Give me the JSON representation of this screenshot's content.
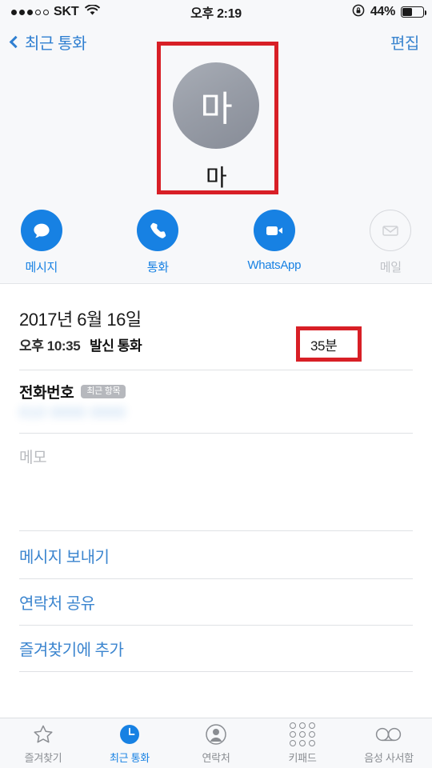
{
  "status_bar": {
    "signal_dots_filled": 3,
    "signal_dots_total": 5,
    "carrier": "SKT",
    "wifi_icon": "wifi-icon",
    "time": "오후 2:19",
    "rotation_lock_icon": "rotation-lock-icon",
    "battery_percent": "44%",
    "battery_level": 44
  },
  "nav_bar": {
    "back_icon": "chevron-left-icon",
    "back_label": "최근 통화",
    "edit_label": "편집"
  },
  "contact": {
    "avatar_initial": "마",
    "avatar_icon": "avatar-placeholder",
    "name": "마"
  },
  "actions": [
    {
      "id": "message",
      "label": "메시지",
      "icon": "message-bubble-icon",
      "enabled": true
    },
    {
      "id": "call",
      "label": "통화",
      "icon": "phone-handset-icon",
      "enabled": true
    },
    {
      "id": "whatsapp",
      "label": "WhatsApp",
      "icon": "video-camera-icon",
      "enabled": true
    },
    {
      "id": "mail",
      "label": "메일",
      "icon": "envelope-icon",
      "enabled": false
    }
  ],
  "call_record": {
    "date": "2017년 6월 16일",
    "time": "오후 10:35",
    "type": "발신 통화",
    "duration": "35분"
  },
  "fields": {
    "phone_label": "전화번호",
    "phone_badge": "최근 항목",
    "phone_value": "",
    "memo_placeholder": "메모"
  },
  "link_rows": [
    {
      "id": "send-message",
      "label": "메시지 보내기"
    },
    {
      "id": "share-contact",
      "label": "연락처 공유"
    },
    {
      "id": "add-favorite",
      "label": "즐겨찾기에 추가"
    }
  ],
  "tab_bar": {
    "active_index": 1,
    "tabs": [
      {
        "id": "favorites",
        "label": "즐겨찾기",
        "icon": "star-icon"
      },
      {
        "id": "recents",
        "label": "최근 통화",
        "icon": "clock-icon"
      },
      {
        "id": "contacts",
        "label": "연락처",
        "icon": "person-circle-icon"
      },
      {
        "id": "keypad",
        "label": "키패드",
        "icon": "keypad-grid-icon"
      },
      {
        "id": "voicemail",
        "label": "음성 사서함",
        "icon": "voicemail-icon"
      }
    ]
  },
  "annotations": {
    "accent_color": "#d81f26",
    "boxes": [
      {
        "id": "avatar-highlight",
        "target": "contact avatar and name"
      },
      {
        "id": "duration-highlight",
        "target": "call duration 35분"
      }
    ]
  },
  "colors": {
    "accent_blue": "#1781e3",
    "link_blue": "#3b85cf",
    "header_bg": "#f7f8fa",
    "annotation_red": "#d81f26",
    "disabled_gray": "#bfc2c7"
  }
}
